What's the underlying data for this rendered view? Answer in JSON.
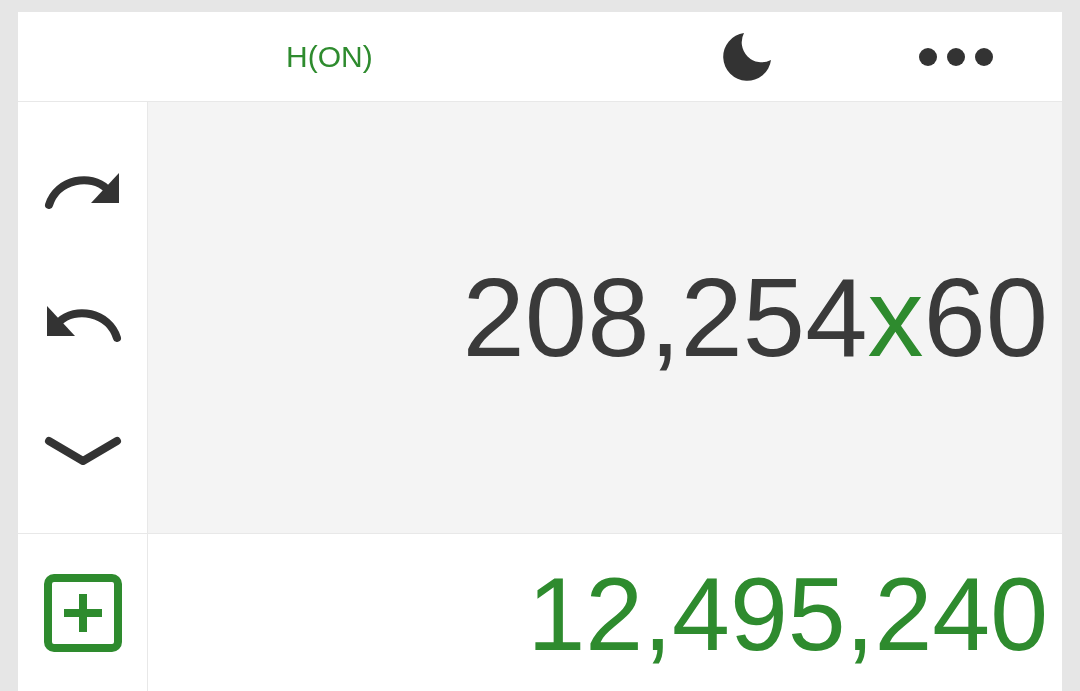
{
  "header": {
    "mode_label": "H(ON)"
  },
  "expression": {
    "tokens": [
      {
        "text": "208,254",
        "kind": "number"
      },
      {
        "text": "x",
        "kind": "operator"
      },
      {
        "text": "60",
        "kind": "number"
      }
    ]
  },
  "result": "12,495,240"
}
